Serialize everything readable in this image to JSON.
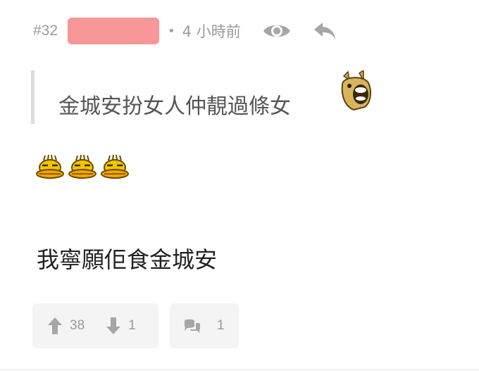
{
  "header": {
    "post_number": "#32",
    "separator": "•",
    "time_ago": "4 小時前",
    "view_icon": "eye-icon",
    "reply_icon": "reply-arrow-icon",
    "username_redaction_color": "#f79797"
  },
  "quote": {
    "text": "金城安扮女人仲靚過條女",
    "emoji": "shouting-horse-emoji"
  },
  "emoji_row": {
    "items": [
      "duck-emoji",
      "duck-emoji",
      "duck-emoji"
    ]
  },
  "body": {
    "text": "我寧願佢食金城安"
  },
  "actions": {
    "upvote_count": "38",
    "downvote_count": "1",
    "comment_count": "1",
    "upvote_icon": "arrow-up-icon",
    "downvote_icon": "arrow-down-icon",
    "comment_icon": "speech-bubbles-icon"
  }
}
